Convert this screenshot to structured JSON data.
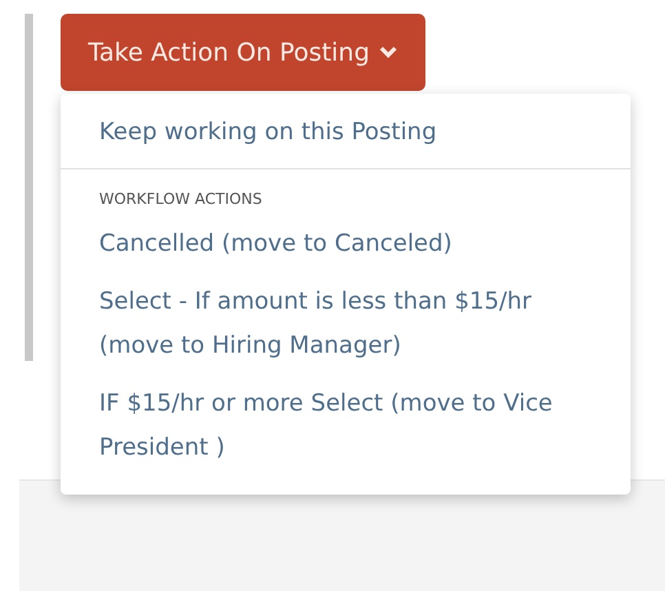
{
  "action_button": {
    "label": "Take Action On Posting",
    "expanded": true
  },
  "menu": {
    "items": [
      {
        "kind": "item",
        "label": "Keep working on this Posting"
      },
      {
        "kind": "divider"
      },
      {
        "kind": "header",
        "label": "WORKFLOW ACTIONS"
      },
      {
        "kind": "item",
        "label": "Cancelled (move to Canceled)"
      },
      {
        "kind": "item",
        "label": "Select - If amount is less than $15/hr (move to Hiring Manager)"
      },
      {
        "kind": "item",
        "label": "IF $15/hr or more Select (move to Vice President )"
      }
    ]
  }
}
